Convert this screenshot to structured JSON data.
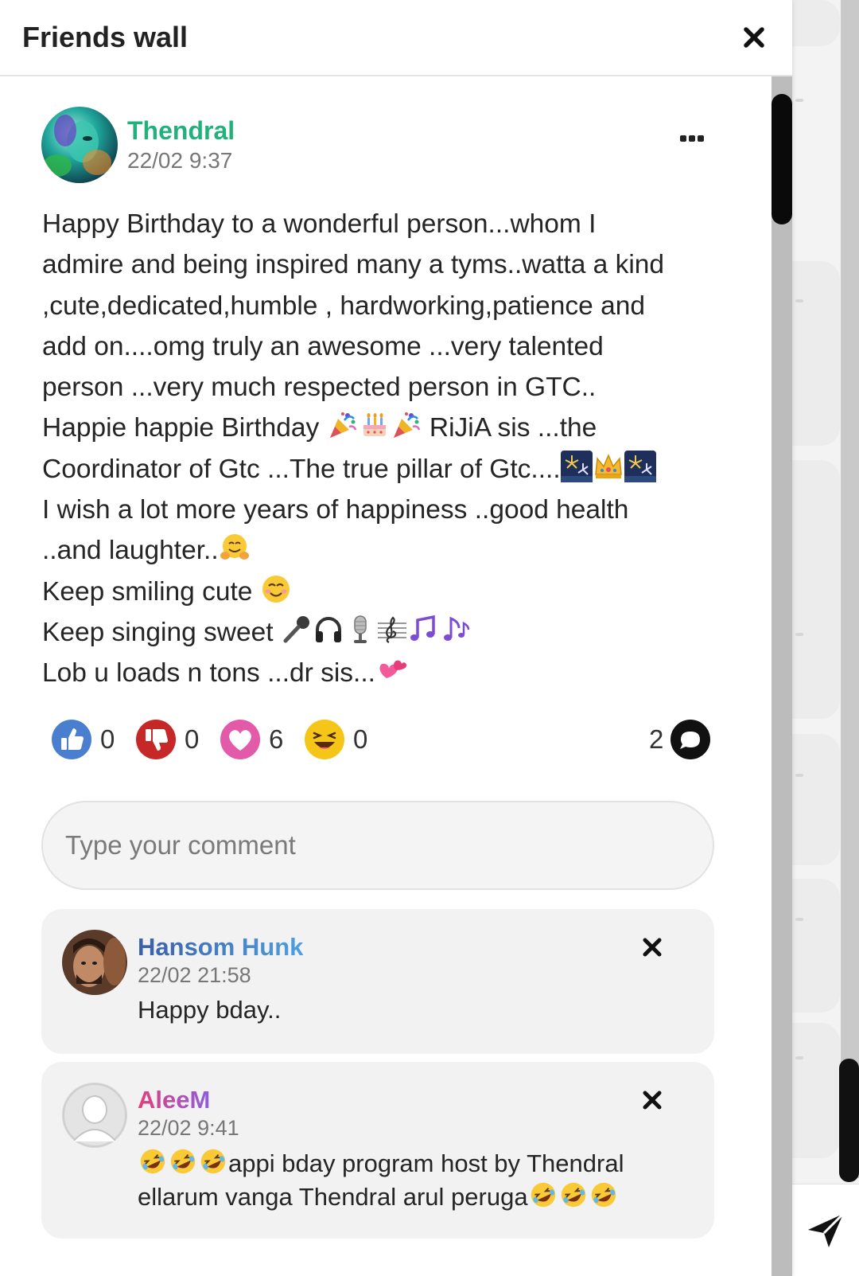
{
  "modal": {
    "title": "Friends wall"
  },
  "post": {
    "author": "Thendral",
    "time": "22/02 9:37",
    "lines": [
      "Happy Birthday to a wonderful person...whom I",
      "admire and being inspired many a tyms..watta a kind",
      ",cute,dedicated,humble , hardworking,patience and",
      "add on....omg truly an awesome ...very talented",
      "person ...very much respected person in GTC..",
      "Happie happie Birthday ",
      " RiJiA sis ...the",
      "Coordinator of Gtc ...The true pillar of Gtc....",
      "I wish a lot more years of happiness ..good health",
      "..and laughter..",
      "Keep smiling cute ",
      "Keep singing sweet ",
      "Lob u loads n tons ...dr sis..."
    ],
    "reactions": {
      "like": "0",
      "dislike": "0",
      "love": "6",
      "laugh": "0"
    },
    "comment_count": "2"
  },
  "comment_box": {
    "placeholder": "Type your comment"
  },
  "comments": [
    {
      "name": "Hansom Hunk",
      "time": "22/02 21:58",
      "text": "Happy bday.."
    },
    {
      "name": "AleeM",
      "time": "22/02 9:41",
      "text_line1": "appi bday program host by Thendral",
      "text_line2": "ellarum vanga Thendral arul peruga"
    }
  ],
  "colors": {
    "author": "#22b07d",
    "like": "#4a7fd0",
    "dislike": "#c62828",
    "love": "#e35aa8",
    "laugh": "#f5c518"
  },
  "icons": {
    "close": "close-icon",
    "more": "more-icon",
    "like": "thumbs-up-icon",
    "dislike": "thumbs-down-icon",
    "love": "heart-icon",
    "laugh": "laughing-emoji-icon",
    "comment": "comment-bubble-icon",
    "send": "send-icon"
  }
}
